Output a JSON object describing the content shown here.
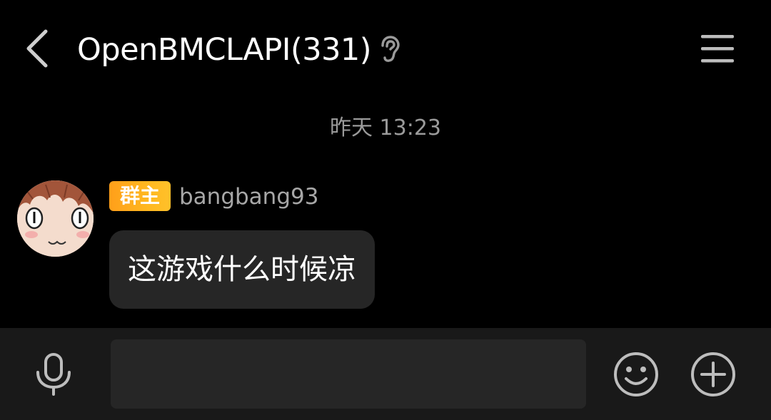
{
  "header": {
    "title": "OpenBMCLAPI(331)",
    "back_icon": "chevron-left-icon",
    "earpiece_icon": "ear-icon",
    "menu_icon": "hamburger-menu-icon"
  },
  "conversation": {
    "timestamp": "昨天 13:23",
    "messages": [
      {
        "role_badge": "群主",
        "sender": "bangbang93",
        "text": "这游戏什么时候凉",
        "avatar_icon": "anime-face-avatar"
      }
    ]
  },
  "input_bar": {
    "voice_icon": "microphone-icon",
    "input_value": "",
    "emoji_icon": "smiley-icon",
    "plus_icon": "plus-circle-icon"
  },
  "colors": {
    "background": "#000000",
    "bubble": "#262626",
    "input_bar": "#191919",
    "badge_gradient_start": "#ff9f1a",
    "badge_gradient_end": "#ffc12a",
    "muted_text": "#9a9a9a"
  }
}
